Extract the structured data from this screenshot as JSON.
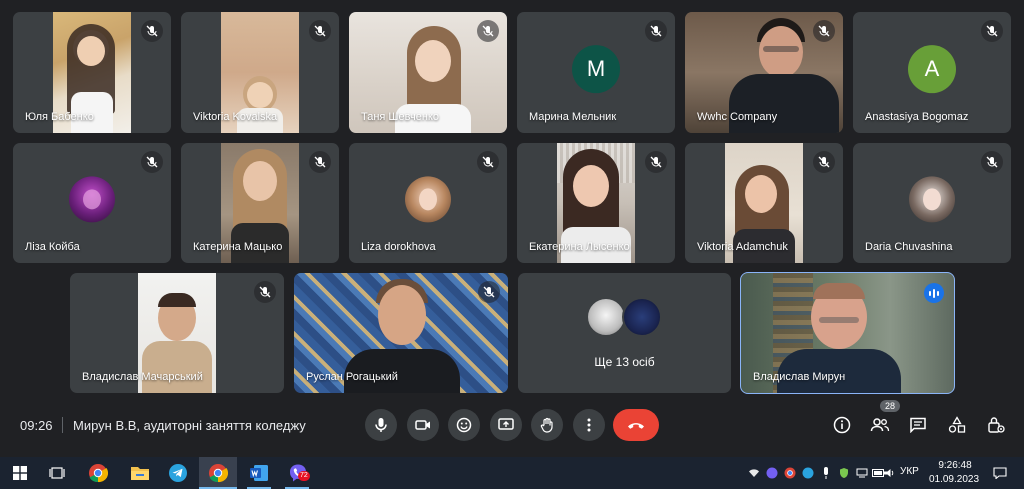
{
  "participants": [
    {
      "name": "Юля Бабенко",
      "muted": true,
      "type": "video"
    },
    {
      "name": "Viktoria Kovalska",
      "muted": true,
      "type": "video"
    },
    {
      "name": "Таня Шевченко",
      "muted": true,
      "type": "video"
    },
    {
      "name": "Марина Мельник",
      "muted": true,
      "type": "avatar",
      "initial": "M",
      "avatar_color": "#0d5447"
    },
    {
      "name": "Wwhc Company",
      "muted": true,
      "type": "video"
    },
    {
      "name": "Anastasiya Bogomaz",
      "muted": true,
      "type": "avatar",
      "initial": "A",
      "avatar_color": "#689f38"
    },
    {
      "name": "Ліза Койба",
      "muted": true,
      "type": "photo"
    },
    {
      "name": "Катерина Мацько",
      "muted": true,
      "type": "video"
    },
    {
      "name": "Liza dorokhova",
      "muted": true,
      "type": "photo"
    },
    {
      "name": "Екатерина Лысенко",
      "muted": true,
      "type": "video"
    },
    {
      "name": "Viktoria Adamchuk",
      "muted": true,
      "type": "video"
    },
    {
      "name": "Daria Chuvashina",
      "muted": true,
      "type": "photo"
    },
    {
      "name": "Владислав Мачарський",
      "muted": true,
      "type": "video"
    },
    {
      "name": "Руслан Рогацький",
      "muted": true,
      "type": "video"
    },
    {
      "name": "Ще 13 осіб",
      "muted": false,
      "type": "others"
    },
    {
      "name": "Владислав Мирун",
      "muted": false,
      "type": "video",
      "speaking": true
    }
  ],
  "meeting": {
    "time": "09:26",
    "title": "Мирун В.В, аудиторні заняття коледжу",
    "participant_count": "28"
  },
  "controls": [
    "mic-icon",
    "camera-icon",
    "emoji-icon",
    "present-icon",
    "raise-hand-icon",
    "more-options-icon",
    "hang-up-icon"
  ],
  "right_controls": [
    "info-icon",
    "people-icon",
    "chat-icon",
    "activities-icon",
    "host-controls-icon"
  ],
  "taskbar": {
    "apps": [
      "windows-start-icon",
      "task-view-icon",
      "chrome-icon",
      "file-explorer-icon",
      "telegram-icon",
      "chrome-icon",
      "word-icon",
      "viber-icon"
    ],
    "viber_badge": "72",
    "language": "УКР",
    "clock_time": "9:26:48",
    "clock_date": "01.09.2023"
  },
  "colors": {
    "background": "#202124",
    "tile": "#3c4043",
    "hangup": "#ea4335",
    "speaking_outline": "#8ab4f8",
    "speaking_badge": "#1a73e8",
    "taskbar": "#1b2330"
  }
}
